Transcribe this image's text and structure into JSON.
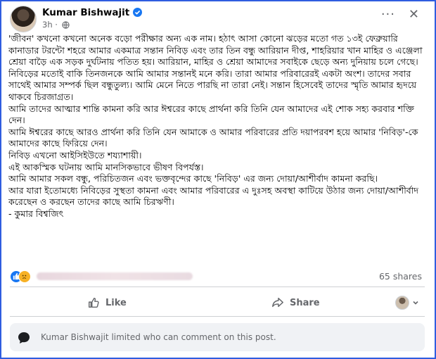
{
  "post": {
    "author": "Kumar Bishwajit",
    "time": "3h",
    "more_label": "···",
    "close_label": "✕",
    "paragraphs": [
      "'জীবন' কখনো কখনো অনেক বড়ো পরীক্ষার অন্য এক নাম। হঠাৎ আসা কোনো ঝড়ের মতো গত ১৩ই ফেব্রুয়ারি কানাডার টরন্টো শহরে আমার একমাত্র সন্তান নিবিড় এবং তার তিন বন্ধু আরিয়ান দীপ্ত, শাহরিয়ার খান মাহির ও এঞ্জেলা শ্রেয়া বাড়ৈ এক সড়ক দুর্ঘটনায় পতিত হয়। আরিয়ান, মাহির ও শ্রেয়া আমাদের সবাইকে ছেড়ে অন্য দুনিয়ায় চলে গেছে।",
      "নিবিড়ের মতোই বাকি তিনজনকে আমি আমার সন্তানই মনে করি। তারা আমার পরিবারেরই একটা অংশ। তাদের সবার সাথেই আমার সম্পর্ক ছিল বন্ধুতুল্য। আমি মেনে নিতে পারছি না তারা নেই। সন্তান হিসেবেই তাদের স্মৃতি আমার হৃদয়ে থাকবে চিরজাগ্রত।",
      "আমি তাদের আত্মার শান্তি কামনা করি আর ঈশ্বরের কাছে প্রার্থনা করি তিনি যেন আমাদের এই শোক সহ্য করবার শক্তি দেন।",
      "আমি ঈশ্বরের কাছে আরও প্রার্থনা করি তিনি যেন আমাকে ও আমার পরিবারের প্রতি দয়াপরবশ হয়ে আমার 'নিবিড়'-কে আমাদের কাছে ফিরিয়ে দেন।",
      "নিবিড় এখনো আইসিইউতে শয্যাশায়ী।",
      "এই আকস্মিক ঘটনায় আমি মানসিকভাবে ভীষণ বিপর্যস্ত।",
      "আমি আমার সকল বন্ধু, পরিচিতজন এবং ভক্তবৃন্দের কাছে 'নিবিড়' এর জন্য দোয়া/আশীর্বাদ কামনা করছি।",
      "আর যারা ইতোমধ্যে নিবিড়ের সুস্থতা কামনা এবং আমার পরিবারের এ দুঃসহ অবস্থা কাটিয়ে উঠার জন্য দোয়া/আশীর্বাদ করেছেন ও করছেন তাদের কাছে আমি চিরঋণী।",
      "- কুমার বিশ্বজিৎ"
    ]
  },
  "reactions": {
    "types": [
      "like",
      "sad"
    ],
    "shares": "65 shares"
  },
  "actions": {
    "like": "Like",
    "share": "Share"
  },
  "notice": "Kumar Bishwajit limited who can comment on this post.",
  "colors": {
    "accent": "#1877f2",
    "muted": "#65676b",
    "frame": "#2f5de0"
  }
}
